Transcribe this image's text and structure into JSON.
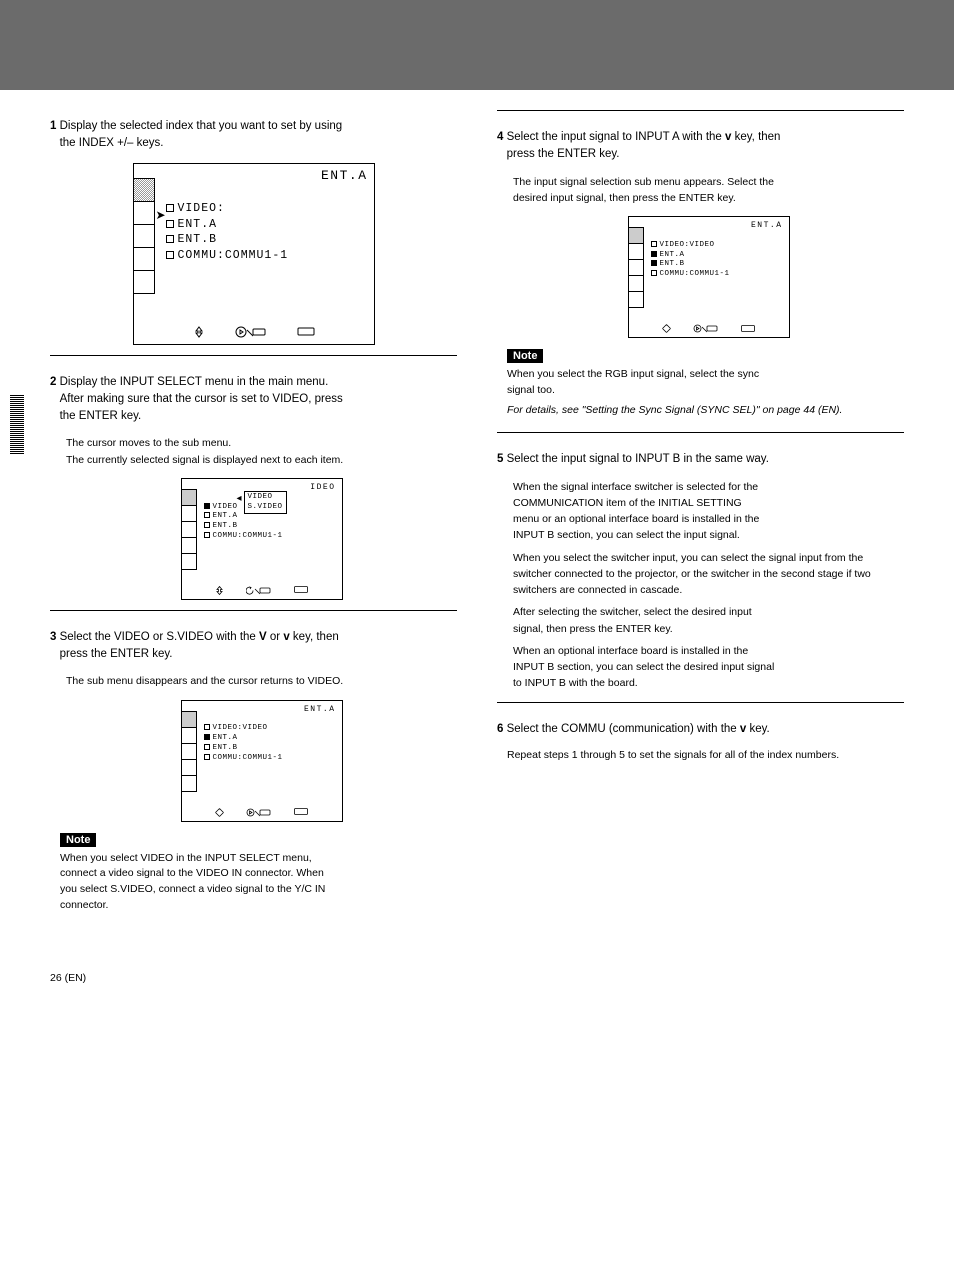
{
  "step1": {
    "num": "1",
    "text": "Display the selected index that you want to set by using",
    "keys": "the INDEX +/– keys."
  },
  "screen1": {
    "corner": "ENT.A",
    "l1": "VIDEO:",
    "l2": "ENT.A",
    "l3": "ENT.B",
    "l4": "COMMU:COMMU1-1"
  },
  "step2": {
    "num": "2",
    "text1": "Display the INPUT SELECT menu in the main menu.",
    "text2": "After making sure that the cursor is set to VIDEO, press",
    "text3": "the ENTER key.",
    "below1": "The cursor moves to the sub menu.",
    "below2": "The currently selected signal is displayed next to each item."
  },
  "screen2": {
    "corner": "IDEO",
    "l1": "VIDEO",
    "l2": "ENT.A",
    "l3": "ENT.B",
    "l4": "COMMU:COMMU1-1",
    "sub1": "VIDEO",
    "sub2": "S.VIDEO"
  },
  "step3": {
    "num": "3",
    "text1": "Select the VIDEO or S.VIDEO with the ",
    "keys1": "V",
    "text2": " or ",
    "keys2": "v",
    "text3": " key, then",
    "text4": "press the ENTER key.",
    "below": "The sub menu disappears and the cursor returns to VIDEO."
  },
  "screen3": {
    "corner": "ENT.A",
    "l1": "VIDEO:VIDEO",
    "l2": "ENT.A",
    "l3": "ENT.B",
    "l4": "COMMU:COMMU1-1"
  },
  "note1": {
    "label": "Note",
    "text1": "When you select VIDEO in the INPUT SELECT menu,",
    "text2": "connect a video signal to the VIDEO IN connector. When",
    "text3": "you select S.VIDEO, connect a video signal to the Y/C IN",
    "text4": "connector."
  },
  "step4": {
    "num": "4",
    "text1": "Select the input signal to INPUT A with the ",
    "keys1": "v",
    "text2": " key, then",
    "text3": "press the ENTER key.",
    "below1": "The input signal selection sub menu appears. Select the",
    "below2": "desired input signal, then press the ENTER key."
  },
  "screen4": {
    "corner": "ENT.A",
    "l1": "VIDEO:VIDEO",
    "l2": "ENT.A",
    "l3": "ENT.B",
    "l4": "COMMU:COMMU1-1"
  },
  "note2": {
    "label": "Note",
    "text1": "When you select the RGB input signal, select the sync",
    "text2": "signal too.",
    "detail": "For details, see \"Setting the Sync Signal (SYNC SEL)\" on page 44 (EN)."
  },
  "step5": {
    "num": "5",
    "text": "Select the input signal to INPUT B in the same way.",
    "below1": "When the signal interface switcher is selected for the",
    "below2": "COMMUNICATION item of the INITIAL SETTING",
    "below3": "menu or an optional interface board is installed in the",
    "below4": "INPUT B section, you can select the input signal."
  },
  "col2para": {
    "p1": "When you select the switcher input, you can select the signal input from the switcher connected to the projector, or the switcher in the second stage if two switchers are connected in cascade.",
    "p2l1": "After selecting the switcher, select the desired input",
    "p2l2": "signal, then press the ENTER key.",
    "p3l1": "When an optional interface board is installed in the",
    "p3l2": "INPUT B section, you can select the desired input signal",
    "p3l3": "to INPUT B with the board."
  },
  "step6": {
    "num": "6",
    "text1": "Select the COMMU (communication) with the ",
    "keys": "v",
    "text2": " key.",
    "below": "Repeat steps 1 through 5 to set the signals for all of the index numbers."
  },
  "pageNum": "26 (EN)"
}
